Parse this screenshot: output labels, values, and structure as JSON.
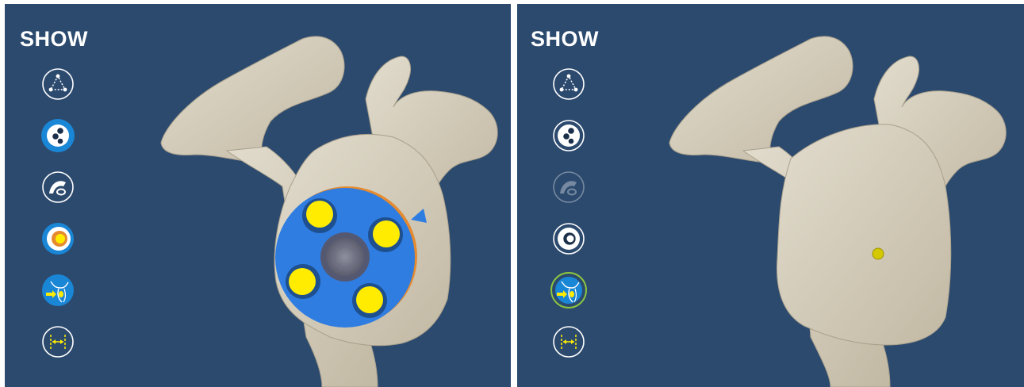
{
  "left_panel": {
    "title": "SHOW",
    "buttons": [
      {
        "icon": "landmarks-triangle-icon",
        "state": "inactive"
      },
      {
        "icon": "pegs-icon",
        "state": "active"
      },
      {
        "icon": "glenoid-surface-icon",
        "state": "inactive"
      },
      {
        "icon": "baseplate-view-icon",
        "state": "active"
      },
      {
        "icon": "scapula-plane-icon",
        "state": "active"
      },
      {
        "icon": "measure-icon",
        "state": "inactive"
      }
    ]
  },
  "right_panel": {
    "title": "SHOW",
    "buttons": [
      {
        "icon": "landmarks-triangle-icon",
        "state": "inactive"
      },
      {
        "icon": "pegs-icon",
        "state": "inactive"
      },
      {
        "icon": "glenoid-surface-icon",
        "state": "disabled"
      },
      {
        "icon": "baseplate-view-icon",
        "state": "inactive"
      },
      {
        "icon": "scapula-plane-icon",
        "state": "selected"
      },
      {
        "icon": "measure-icon",
        "state": "inactive"
      }
    ]
  },
  "colors": {
    "background": "#2c4a6e",
    "bone": "#d8d1c0",
    "baseplate": "#2f7de1",
    "peg": "#ffec00",
    "selection_ring": "#8cc63f",
    "active_button": "#1a86d6"
  }
}
